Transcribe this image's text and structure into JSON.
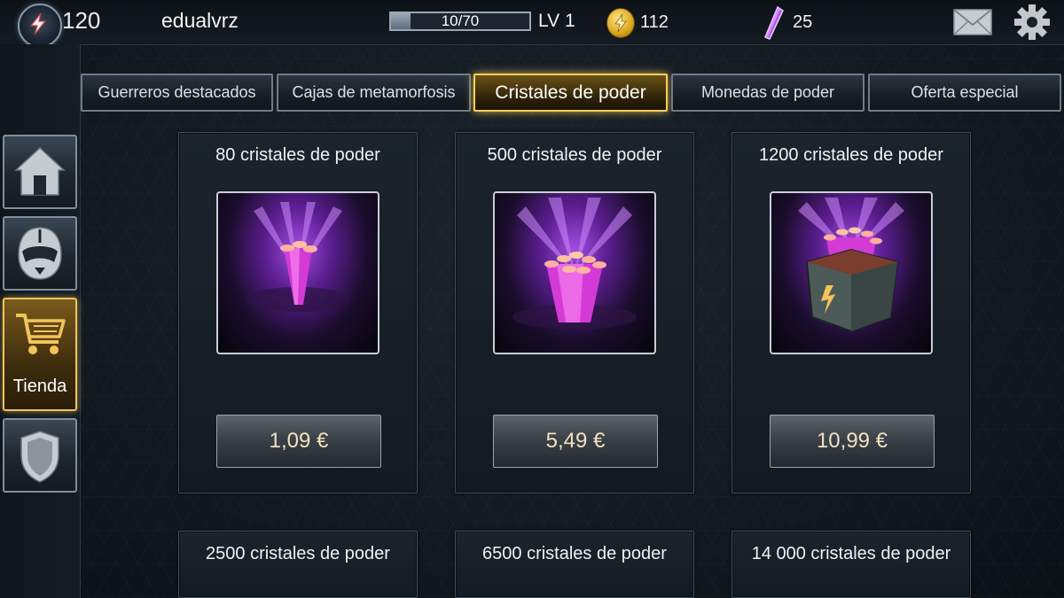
{
  "header": {
    "player_power": "120",
    "username": "edualvrz",
    "xp_text": "10/70",
    "xp_progress": 0.143,
    "level": "LV 1",
    "coins": "112",
    "crystals": "25",
    "icons": [
      "power-emblem-icon",
      "coin-icon",
      "crystal-icon",
      "mail-icon",
      "gear-icon"
    ]
  },
  "sidebar": {
    "items": [
      {
        "name": "home",
        "icon": "house-icon",
        "label": ""
      },
      {
        "name": "rangers",
        "icon": "ranger-helmet-icon",
        "label": ""
      },
      {
        "name": "shop",
        "icon": "shopping-cart-icon",
        "label": "Tienda"
      },
      {
        "name": "shield",
        "icon": "shield-icon",
        "label": ""
      }
    ]
  },
  "tabs": [
    {
      "label": "Guerreros destacados",
      "active": false
    },
    {
      "label": "Cajas de metamorfosis",
      "active": false
    },
    {
      "label": "Cristales de poder",
      "active": true
    },
    {
      "label": "Monedas de poder",
      "active": false
    },
    {
      "label": "Oferta especial",
      "active": false
    }
  ],
  "products": [
    {
      "title": "80 cristales de poder",
      "price": "1,09 €",
      "image": "crystal-small-bundle"
    },
    {
      "title": "500 cristales de poder",
      "price": "5,49 €",
      "image": "crystal-cluster"
    },
    {
      "title": "1200 cristales de poder",
      "price": "10,99 €",
      "image": "crystal-chest"
    },
    {
      "title": "2500 cristales de poder",
      "price": "",
      "image": ""
    },
    {
      "title": "6500 cristales de poder",
      "price": "",
      "image": ""
    },
    {
      "title": "14 000 cristales de poder",
      "price": "",
      "image": ""
    }
  ],
  "colors": {
    "accent_gold": "#f5cf5c",
    "crystal_purple": "#c94de8",
    "price_text": "#f0e2bf"
  }
}
